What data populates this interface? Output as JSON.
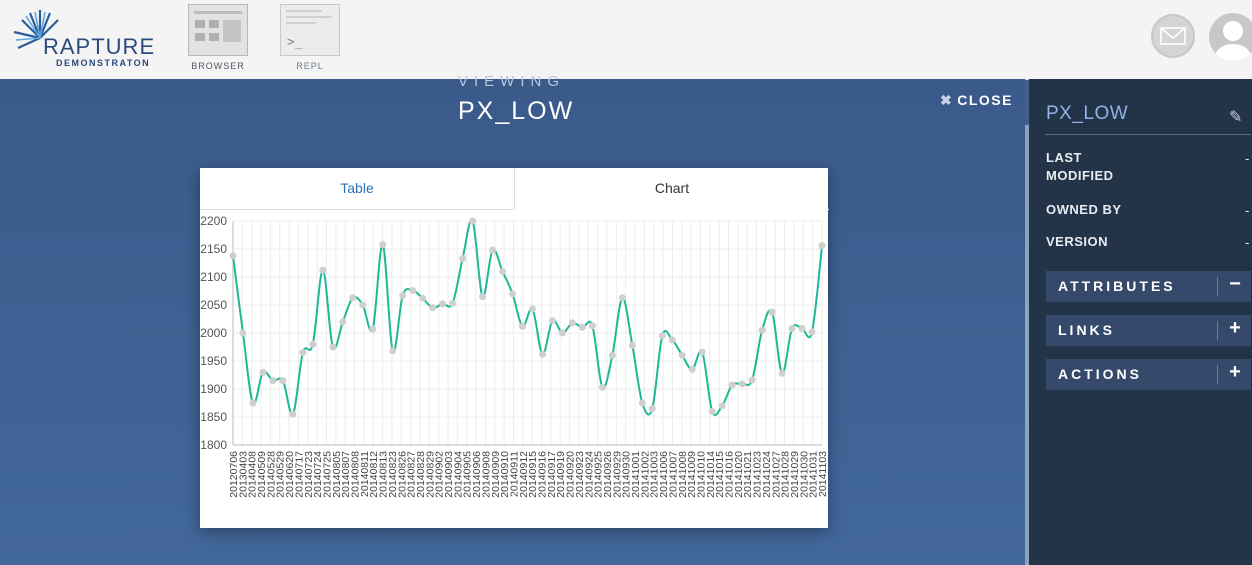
{
  "logo": {
    "name": "RAPTURE",
    "sub": "DEMONSTRATON"
  },
  "nav": {
    "browser_label": "BROWSER",
    "repl_label": "REPL",
    "repl_prompt": ">_"
  },
  "viewer": {
    "heading": "VIEWING",
    "title": "PX_LOW",
    "close_label": "CLOSE",
    "close_icon": "✖"
  },
  "tabs": {
    "table_label": "Table",
    "chart_label": "Chart",
    "active": "Chart"
  },
  "sidebar": {
    "title": "PX_LOW",
    "fields": [
      {
        "label": "LAST MODIFIED",
        "value": "-"
      },
      {
        "label": "OWNED BY",
        "value": "-"
      },
      {
        "label": "VERSION",
        "value": "-"
      }
    ],
    "sections": [
      {
        "label": "ATTRIBUTES",
        "toggle": "−"
      },
      {
        "label": "LINKS",
        "toggle": "+"
      },
      {
        "label": "ACTIONS",
        "toggle": "+"
      }
    ]
  },
  "colors": {
    "line": "#1fb896",
    "point": "#cfcfcf",
    "grid": "#ececec",
    "accent": "#8fb4e6"
  },
  "chart_data": {
    "type": "line",
    "ylim": [
      1800,
      2200
    ],
    "yticks": [
      1800,
      1850,
      1900,
      1950,
      2000,
      2050,
      2100,
      2150,
      2200
    ],
    "xtick_labels": [
      "20120706",
      "20130403",
      "20140408",
      "20140509",
      "20140528",
      "20140529",
      "20140620",
      "20140717",
      "20140723",
      "20140724",
      "20140725",
      "20140805",
      "20140807",
      "20140808",
      "20140811",
      "20140812",
      "20140813",
      "20140823",
      "20140826",
      "20140827",
      "20140828",
      "20140829",
      "20140902",
      "20140903",
      "20140904",
      "20140905",
      "20140906",
      "20140908",
      "20140909",
      "20140910",
      "20140911",
      "20140912",
      "20140915",
      "20140916",
      "20140917",
      "20140919",
      "20140920",
      "20140923",
      "20140924",
      "20140925",
      "20140926",
      "20140929",
      "20140930",
      "20141001",
      "20141002",
      "20141003",
      "20141006",
      "20141007",
      "20141008",
      "20141009",
      "20141010",
      "20141014",
      "20141015",
      "20141016",
      "20141020",
      "20141021",
      "20141023",
      "20141024",
      "20141027",
      "20141028",
      "20141029",
      "20141030",
      "20141031",
      "20141103"
    ],
    "values": [
      2138,
      2000,
      1875,
      1930,
      1915,
      1915,
      1855,
      1965,
      1980,
      2112,
      1975,
      2020,
      2063,
      2050,
      2007,
      2158,
      1968,
      2067,
      2076,
      2062,
      2045,
      2052,
      2053,
      2133,
      2200,
      2065,
      2148,
      2110,
      2070,
      2012,
      2043,
      1962,
      2022,
      2000,
      2018,
      2010,
      2013,
      1903,
      1960,
      2063,
      1978,
      1875,
      1865,
      1995,
      1988,
      1960,
      1935,
      1966,
      1860,
      1870,
      1907,
      1909,
      1916,
      2005,
      2037,
      1928,
      2008,
      2008,
      2002,
      2156
    ]
  }
}
